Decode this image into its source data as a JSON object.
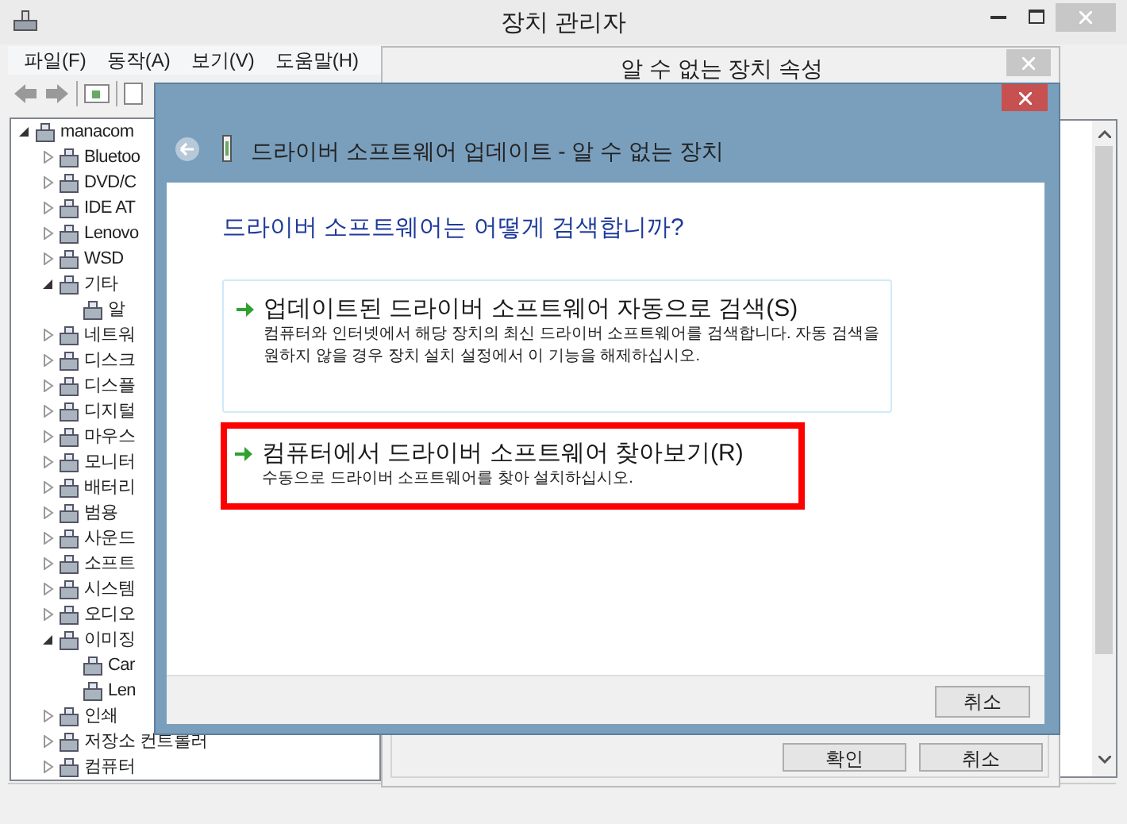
{
  "window": {
    "title": "장치 관리자"
  },
  "menu": [
    "파일(F)",
    "동작(A)",
    "보기(V)",
    "도움말(H)"
  ],
  "tree": [
    {
      "label": "manacom",
      "expanded": true,
      "children": [
        {
          "label": "Bluetoo",
          "expanded": false
        },
        {
          "label": "DVD/C",
          "expanded": false
        },
        {
          "label": "IDE AT",
          "expanded": false
        },
        {
          "label": "Lenovo",
          "expanded": false
        },
        {
          "label": "WSD",
          "expanded": false
        },
        {
          "label": "기타",
          "expanded": true,
          "children": [
            {
              "label": "알"
            }
          ]
        },
        {
          "label": "네트워",
          "expanded": false
        },
        {
          "label": "디스크",
          "expanded": false
        },
        {
          "label": "디스플",
          "expanded": false
        },
        {
          "label": "디지털",
          "expanded": false
        },
        {
          "label": "마우스",
          "expanded": false
        },
        {
          "label": "모니터",
          "expanded": false
        },
        {
          "label": "배터리",
          "expanded": false
        },
        {
          "label": "범용",
          "expanded": false
        },
        {
          "label": "사운드",
          "expanded": false
        },
        {
          "label": "소프트",
          "expanded": false
        },
        {
          "label": "시스템",
          "expanded": false
        },
        {
          "label": "오디오",
          "expanded": false
        },
        {
          "label": "이미징",
          "expanded": true,
          "children": [
            {
              "label": "Car"
            },
            {
              "label": "Len"
            }
          ]
        },
        {
          "label": "인쇄",
          "expanded": false
        },
        {
          "label": "저장소 컨트롤러",
          "expanded": false
        },
        {
          "label": "컴퓨터",
          "expanded": false
        }
      ]
    }
  ],
  "properties_dialog": {
    "title": "알 수 없는 장치 속성",
    "buttons": [
      "확인",
      "취소"
    ]
  },
  "wizard": {
    "title": "드라이버 소프트웨어 업데이트 - 알 수 없는 장치",
    "heading": "드라이버 소프트웨어는 어떻게 검색합니까?",
    "options": [
      {
        "title": "업데이트된 드라이버 소프트웨어 자동으로 검색(S)",
        "description": "컴퓨터와 인터넷에서 해당 장치의 최신 드라이버 소프트웨어를 검색합니다. 자동 검색을 원하지 않을 경우 장치 설치 설정에서 이 기능을 해제하십시오.",
        "highlighted": false
      },
      {
        "title": "컴퓨터에서 드라이버 소프트웨어 찾아보기(R)",
        "description": "수동으로 드라이버 소프트웨어를 찾아 설치하십시오.",
        "highlighted": true
      }
    ],
    "cancel": "취소"
  }
}
